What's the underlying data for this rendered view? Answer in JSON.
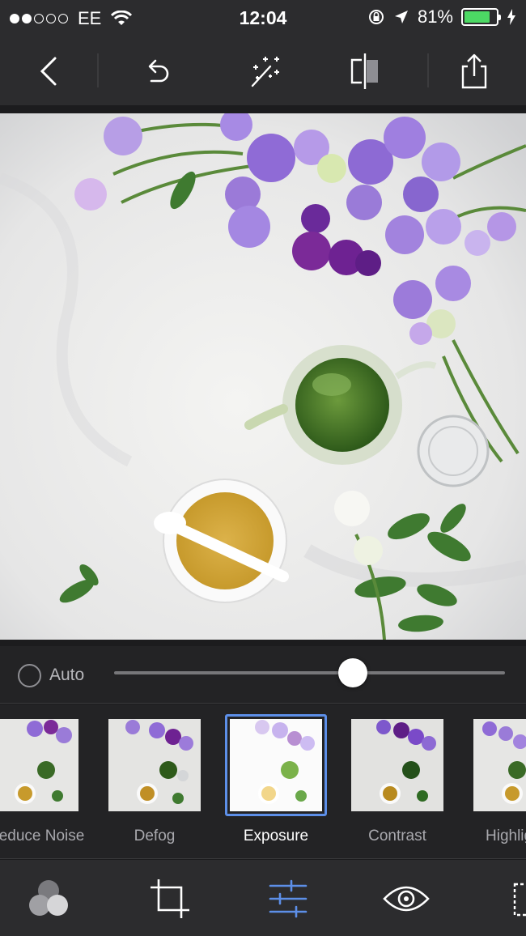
{
  "status_bar": {
    "carrier": "EE",
    "time": "12:04",
    "battery_percent": "81%",
    "battery_level": 0.81,
    "signal_bars_filled": 2,
    "signal_bars_total": 5,
    "battery_color": "#4cd964"
  },
  "toolbar": {
    "icons": [
      "back-icon",
      "undo-icon",
      "magic-wand-icon",
      "compare-icon",
      "share-icon"
    ]
  },
  "adjust": {
    "auto_label": "Auto",
    "slider_value": 0.61
  },
  "filters": [
    {
      "label": "Reduce Noise",
      "selected": false
    },
    {
      "label": "Defog",
      "selected": false
    },
    {
      "label": "Exposure",
      "selected": true
    },
    {
      "label": "Contrast",
      "selected": false
    },
    {
      "label": "Highlights",
      "selected": false
    }
  ],
  "bottom_bar": {
    "icons": [
      "looks-icon",
      "crop-icon",
      "adjustments-icon",
      "eye-icon",
      "border-icon"
    ],
    "active_icon": "adjustments-icon",
    "accent_color": "#5d8fe8"
  }
}
